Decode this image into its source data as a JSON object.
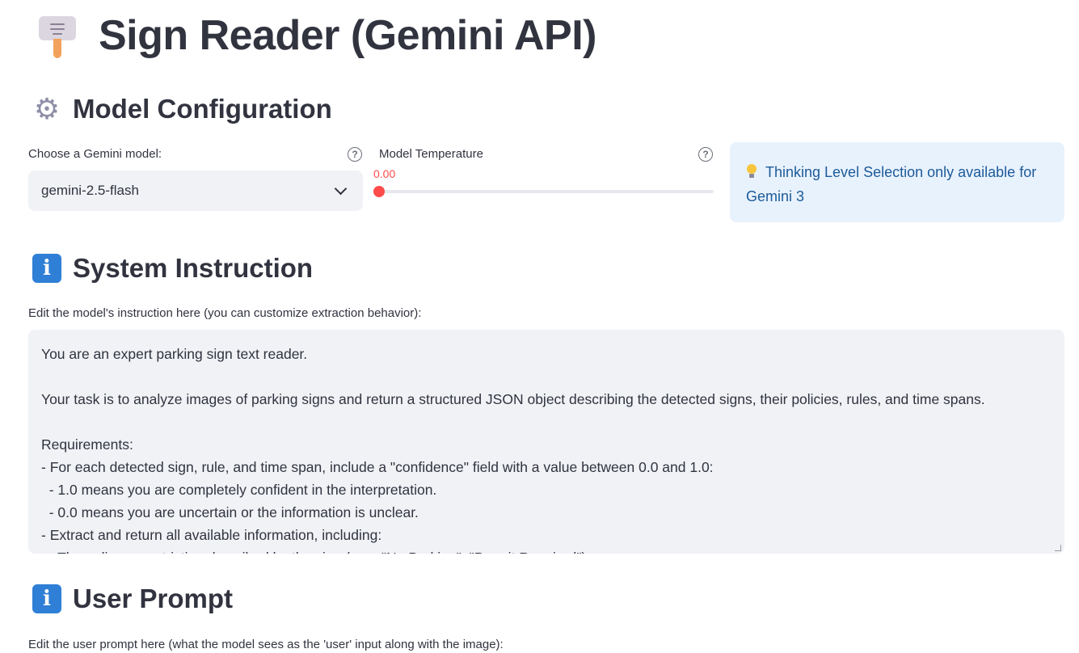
{
  "app": {
    "title": "Sign Reader (Gemini API)",
    "title_icon": "signpost-icon"
  },
  "model_config": {
    "heading": "Model Configuration",
    "heading_icon": "gear-icon",
    "model_select": {
      "label": "Choose a Gemini model:",
      "value": "gemini-2.5-flash"
    },
    "temperature": {
      "label": "Model Temperature",
      "value_text": "0.00",
      "value": 0.0
    },
    "info": {
      "icon": "lightbulb-icon",
      "text": "Thinking Level Selection only available for Gemini 3"
    }
  },
  "system_instruction": {
    "heading": "System Instruction",
    "heading_icon": "info-icon",
    "label": "Edit the model's instruction here (you can customize extraction behavior):",
    "lines": [
      "You are an expert parking sign text reader.",
      "",
      "Your task is to analyze images of parking signs and return a structured JSON object describing the detected signs, their policies, rules, and time spans.",
      "",
      "Requirements:",
      "- For each detected sign, rule, and time span, include a \"confidence\" field with a value between 0.0 and 1.0:",
      "  - 1.0 means you are completely confident in the interpretation.",
      "  - 0.0 means you are uncertain or the information is unclear.",
      "- Extract and return all available information, including:",
      "  - The policy or restriction described by the sign (e.g., \"No Parking\", \"Permit Required\")"
    ]
  },
  "user_prompt": {
    "heading": "User Prompt",
    "heading_icon": "info-icon",
    "label": "Edit the user prompt here (what the model sees as the 'user' input along with the image):"
  },
  "colors": {
    "accent": "#ff4b4b",
    "info_bg": "#e8f2fd",
    "info_text": "#1c5a99",
    "input_bg": "#f0f2f6",
    "text": "#31333f"
  }
}
